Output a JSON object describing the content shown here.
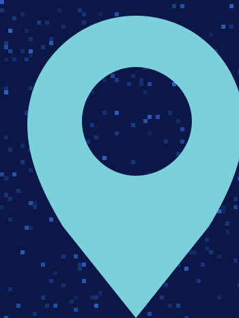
{
  "icon": {
    "name": "location-pin-icon",
    "meaning": "map marker"
  },
  "colors": {
    "background": "#0a1845",
    "background_speck": "#3a6ad8",
    "background_speck_dim": "#1d3a8a",
    "pin_fill": "#7ccfdc",
    "pin_hole": "#0a1845"
  }
}
